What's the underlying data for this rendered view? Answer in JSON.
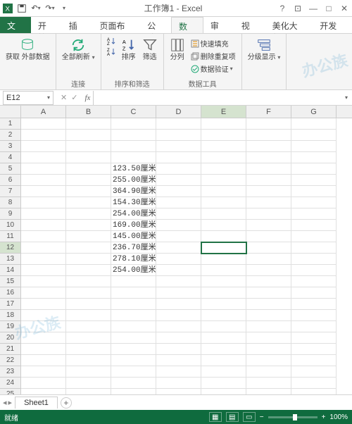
{
  "qat": {
    "title": "工作簿1 - Excel"
  },
  "tabs": {
    "file": "文件",
    "home": "开始",
    "insert": "插入",
    "layout": "页面布局",
    "formulas": "公式",
    "data": "数据",
    "review": "审阅",
    "view": "视图",
    "beautify": "美化大师",
    "dev": "开发工"
  },
  "ribbon": {
    "getdata": "获取\n外部数据",
    "refresh": "全部刷新",
    "connections": "连接",
    "sort": "排序",
    "filter": "筛选",
    "sortfilter": "排序和筛选",
    "columns": "分列",
    "flashfill": "快速填充",
    "removedup": "删除重复项",
    "validate": "数据验证",
    "datatools": "数据工具",
    "outline": "分级显示"
  },
  "namebox": {
    "cell": "E12"
  },
  "columns": [
    "A",
    "B",
    "C",
    "D",
    "E",
    "F",
    "G"
  ],
  "rows": 26,
  "activeRow": 12,
  "activeCol": 4,
  "cells": {
    "5": {
      "2": "123.50厘米"
    },
    "6": {
      "2": "255.00厘米"
    },
    "7": {
      "2": "364.90厘米"
    },
    "8": {
      "2": "154.30厘米"
    },
    "9": {
      "2": "254.00厘米"
    },
    "10": {
      "2": "169.00厘米"
    },
    "11": {
      "2": "145.00厘米"
    },
    "12": {
      "2": "236.70厘米"
    },
    "13": {
      "2": "278.10厘米"
    },
    "14": {
      "2": "254.00厘米"
    }
  },
  "sheet": {
    "name": "Sheet1"
  },
  "status": {
    "ready": "就绪",
    "zoom": "100%"
  },
  "watermark": "办公族"
}
